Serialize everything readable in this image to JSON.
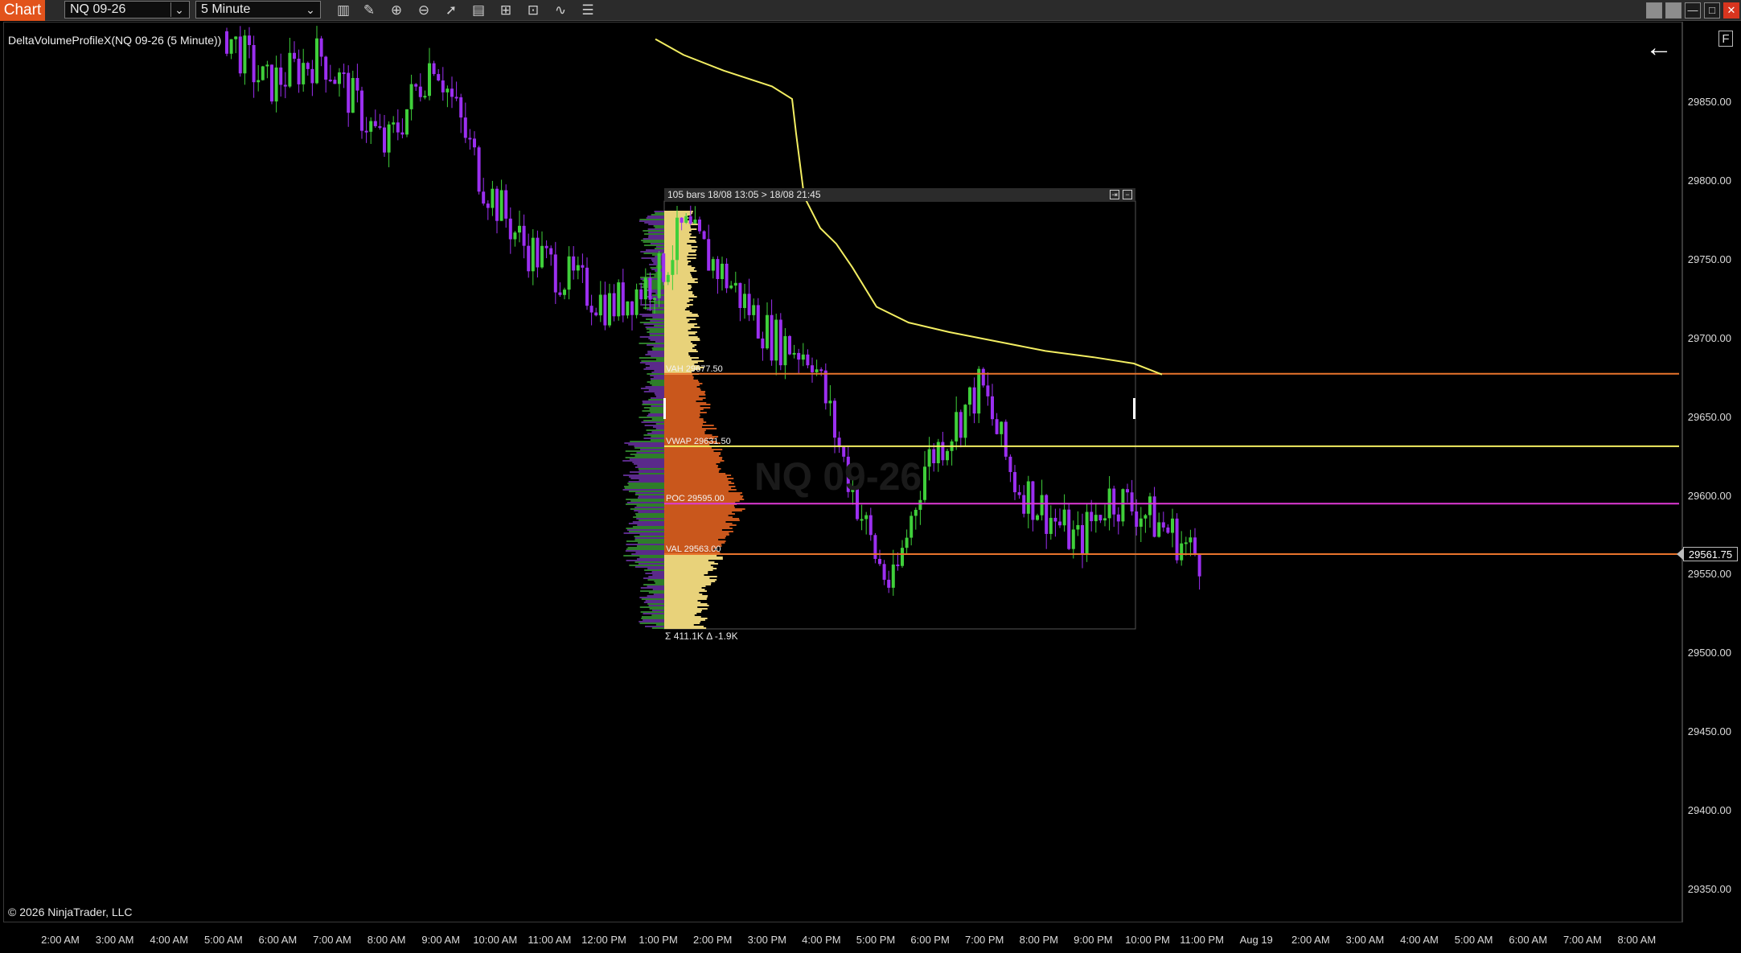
{
  "app": {
    "title": "Chart"
  },
  "toolbar": {
    "instrument": "NQ 09-26",
    "interval": "5 Minute",
    "tools": [
      {
        "name": "bars-type-icon",
        "glyph": "▥"
      },
      {
        "name": "draw-pencil-icon",
        "glyph": "✎"
      },
      {
        "name": "zoom-in-icon",
        "glyph": "⊕"
      },
      {
        "name": "zoom-out-icon",
        "glyph": "⊖"
      },
      {
        "name": "pointer-icon",
        "glyph": "➚"
      },
      {
        "name": "properties-icon",
        "glyph": "▤"
      },
      {
        "name": "data-box-icon",
        "glyph": "⊞"
      },
      {
        "name": "strategies-icon",
        "glyph": "⊡"
      },
      {
        "name": "indicators-icon",
        "glyph": "∿"
      },
      {
        "name": "templates-icon",
        "glyph": "☰"
      },
      {
        "name": "list-icon",
        "glyph": "≣"
      }
    ]
  },
  "window_buttons": [
    {
      "name": "tile-left-button",
      "glyph": ""
    },
    {
      "name": "tile-right-button",
      "glyph": ""
    },
    {
      "name": "minimize-button",
      "glyph": "—"
    },
    {
      "name": "maximize-button",
      "glyph": "□"
    },
    {
      "name": "close-button",
      "glyph": "✕"
    }
  ],
  "chart": {
    "indicator_label": "DeltaVolumeProfileX(NQ 09-26 (5 Minute))",
    "copyright": "© 2026 NinjaTrader, LLC",
    "back_icon": "←",
    "f_button": "F",
    "watermark": "NQ 09-26",
    "last_price": "29561.75",
    "price_axis": [
      "29850.00",
      "29800.00",
      "29750.00",
      "29700.00",
      "29650.00",
      "29600.00",
      "29550.00",
      "29500.00",
      "29450.00",
      "29400.00",
      "29350.00"
    ],
    "time_axis": [
      "2:00 AM",
      "3:00 AM",
      "4:00 AM",
      "5:00 AM",
      "6:00 AM",
      "7:00 AM",
      "8:00 AM",
      "9:00 AM",
      "10:00 AM",
      "11:00 AM",
      "12:00 PM",
      "1:00 PM",
      "2:00 PM",
      "3:00 PM",
      "4:00 PM",
      "5:00 PM",
      "6:00 PM",
      "7:00 PM",
      "8:00 PM",
      "9:00 PM",
      "10:00 PM",
      "11:00 PM",
      "Aug 19",
      "2:00 AM",
      "3:00 AM",
      "4:00 AM",
      "5:00 AM",
      "6:00 AM",
      "7:00 AM",
      "8:00 AM"
    ]
  },
  "volume_profile": {
    "header": "105 bars  18/08 13:05 > 18/08 21:45",
    "vah": "VAH 29677.50",
    "vwap": "VWAP 29631.50",
    "poc": "POC 29595.00",
    "val": "VAL 29563.00",
    "summary": "Σ 411.1K   Δ -1.9K",
    "levels": {
      "vah": 29677.5,
      "vwap": 29631.5,
      "poc": 29595.0,
      "val": 29563.0
    }
  },
  "colors": {
    "up_bar": "#3fcf3a",
    "down_bar": "#9b2ff0",
    "vah_line": "#e8742c",
    "val_line": "#e8742c",
    "vwap_line": "#f3ee62",
    "poc_line": "#e03ad6",
    "profile_fill": "#e8d27a",
    "value_area_fill": "#c9571c"
  }
}
